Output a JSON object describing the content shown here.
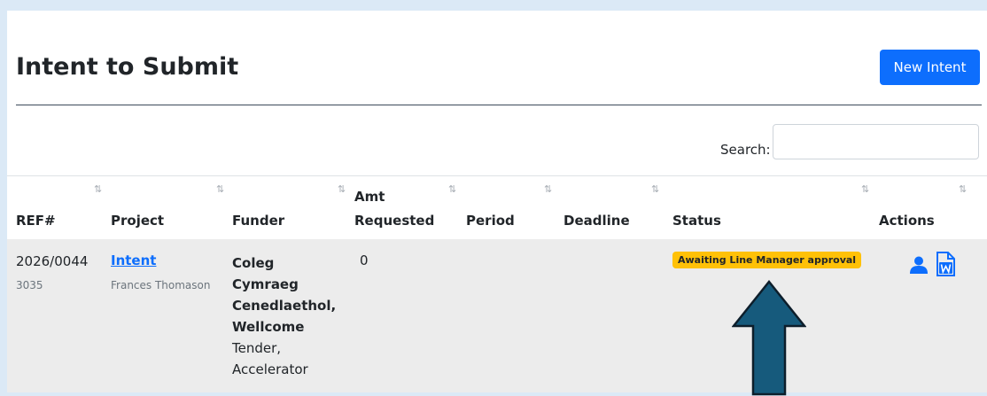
{
  "page": {
    "title": "Intent to Submit",
    "new_button": "New Intent",
    "search_label": "Search:",
    "search_value": ""
  },
  "table": {
    "columns": [
      "REF#",
      "Project",
      "Funder",
      "Amt",
      "Requested",
      "Period",
      "Deadline",
      "Status",
      "Actions"
    ],
    "rows": [
      {
        "ref": "2026/0044",
        "ref_sub": "3035",
        "project": "Intent",
        "person": "Frances Thomason",
        "funder_lines": [
          "Coleg",
          "Cymraeg",
          "Cenedlaethol,",
          "Wellcome"
        ],
        "scheme_lines": [
          "Tender,",
          "Accelerator"
        ],
        "amount": "0",
        "period": "",
        "deadline": "",
        "status": "Awaiting Line Manager approval"
      }
    ]
  },
  "colors": {
    "primary": "#0d6efd",
    "badge_warning": "#ffc107",
    "arrow": "#165a7c",
    "background": "#dbe9f6"
  },
  "icons": [
    "sort-icon",
    "person-icon",
    "word-document-icon",
    "up-arrow-annotation"
  ]
}
